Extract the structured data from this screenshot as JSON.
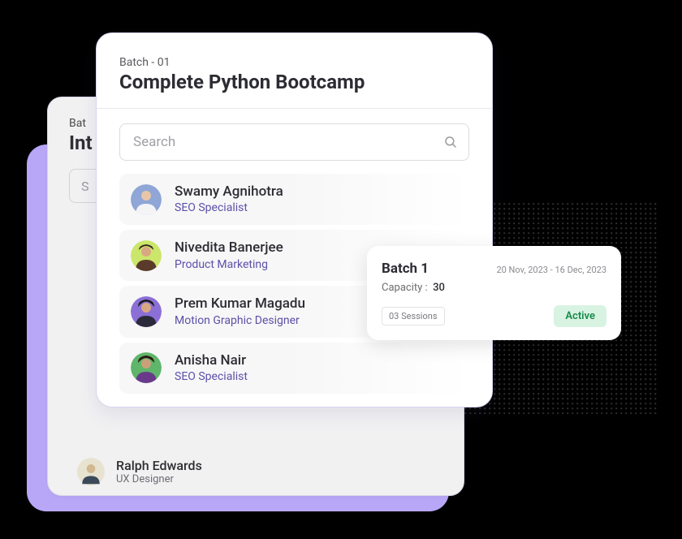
{
  "back_card": {
    "batch_label": "Bat",
    "title": "Int",
    "search_placeholder": "S",
    "members": [
      {
        "name": "Ralph Edwards",
        "role": "UX Designer",
        "avatar_bg": "#e8e3d0"
      }
    ]
  },
  "front_card": {
    "batch_label": "Batch - 01",
    "title": "Complete Python Bootcamp",
    "search_placeholder": "Search",
    "members": [
      {
        "name": "Swamy Agnihotra",
        "role": "SEO Specialist",
        "avatar_bg": "#8fa6d6"
      },
      {
        "name": "Nivedita Banerjee",
        "role": "Product Marketing",
        "avatar_bg": "#cbe66a"
      },
      {
        "name": "Prem Kumar Magadu",
        "role": "Motion Graphic Designer",
        "avatar_bg": "#8b6fd6"
      },
      {
        "name": "Anisha Nair",
        "role": "SEO Specialist",
        "avatar_bg": "#5fb56a"
      }
    ]
  },
  "status_card": {
    "title": "Batch 1",
    "dates": "20 Nov, 2023 - 16 Dec, 2023",
    "capacity_label": "Capacity :",
    "capacity_value": "30",
    "sessions": "03 Sessions",
    "status": "Active"
  }
}
